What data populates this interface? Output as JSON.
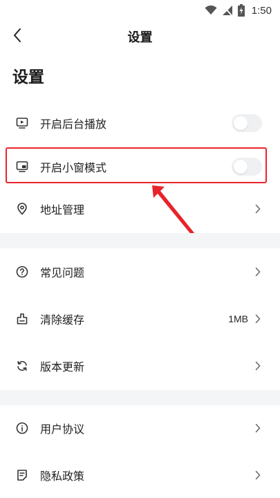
{
  "status_bar": {
    "time": "1:50"
  },
  "nav": {
    "title": "设置"
  },
  "page": {
    "title": "设置"
  },
  "colors": {
    "highlight": "#e8232a",
    "toggle_off": "#eef0f2",
    "section_bg": "#f4f5f7"
  },
  "items": [
    {
      "label": "开启后台播放",
      "icon": "play-screen-icon",
      "type": "toggle",
      "on": false
    },
    {
      "label": "开启小窗模式",
      "icon": "picture-in-picture-icon",
      "type": "toggle",
      "on": false
    },
    {
      "label": "地址管理",
      "icon": "location-pin-icon",
      "type": "link"
    },
    {
      "label": "常见问题",
      "icon": "question-circle-icon",
      "type": "link"
    },
    {
      "label": "清除缓存",
      "icon": "clear-cache-icon",
      "type": "link",
      "value": "1MB"
    },
    {
      "label": "版本更新",
      "icon": "refresh-icon",
      "type": "link"
    },
    {
      "label": "用户协议",
      "icon": "info-circle-icon",
      "type": "link"
    },
    {
      "label": "隐私政策",
      "icon": "document-icon",
      "type": "link"
    }
  ]
}
